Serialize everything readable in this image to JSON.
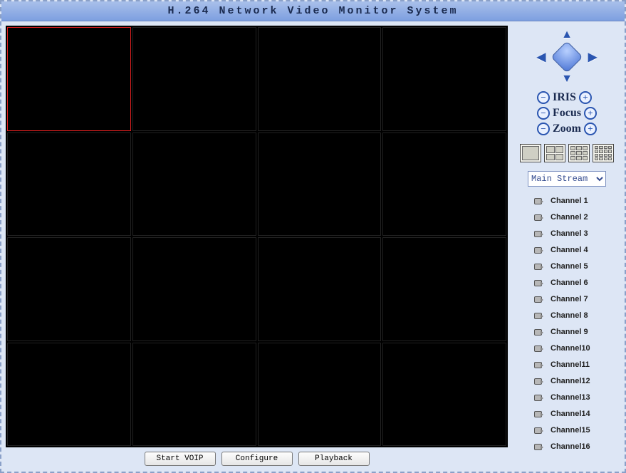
{
  "title": "H.264 Network Video Monitor System",
  "grid": {
    "rows": 4,
    "cols": 4,
    "selected_index": 0
  },
  "ptz_controls": [
    {
      "name": "iris",
      "label": "IRIS"
    },
    {
      "name": "focus",
      "label": "Focus"
    },
    {
      "name": "zoom",
      "label": "Zoom"
    }
  ],
  "layouts": [
    "1",
    "4",
    "9",
    "16"
  ],
  "stream": {
    "selected": "Main Stream",
    "options": [
      "Main Stream"
    ]
  },
  "channels": [
    "Channel 1",
    "Channel 2",
    "Channel 3",
    "Channel 4",
    "Channel 5",
    "Channel 6",
    "Channel 7",
    "Channel 8",
    "Channel 9",
    "Channel10",
    "Channel11",
    "Channel12",
    "Channel13",
    "Channel14",
    "Channel15",
    "Channel16"
  ],
  "buttons": {
    "start_voip": "Start VOIP",
    "configure": "Configure",
    "playback": "Playback"
  }
}
